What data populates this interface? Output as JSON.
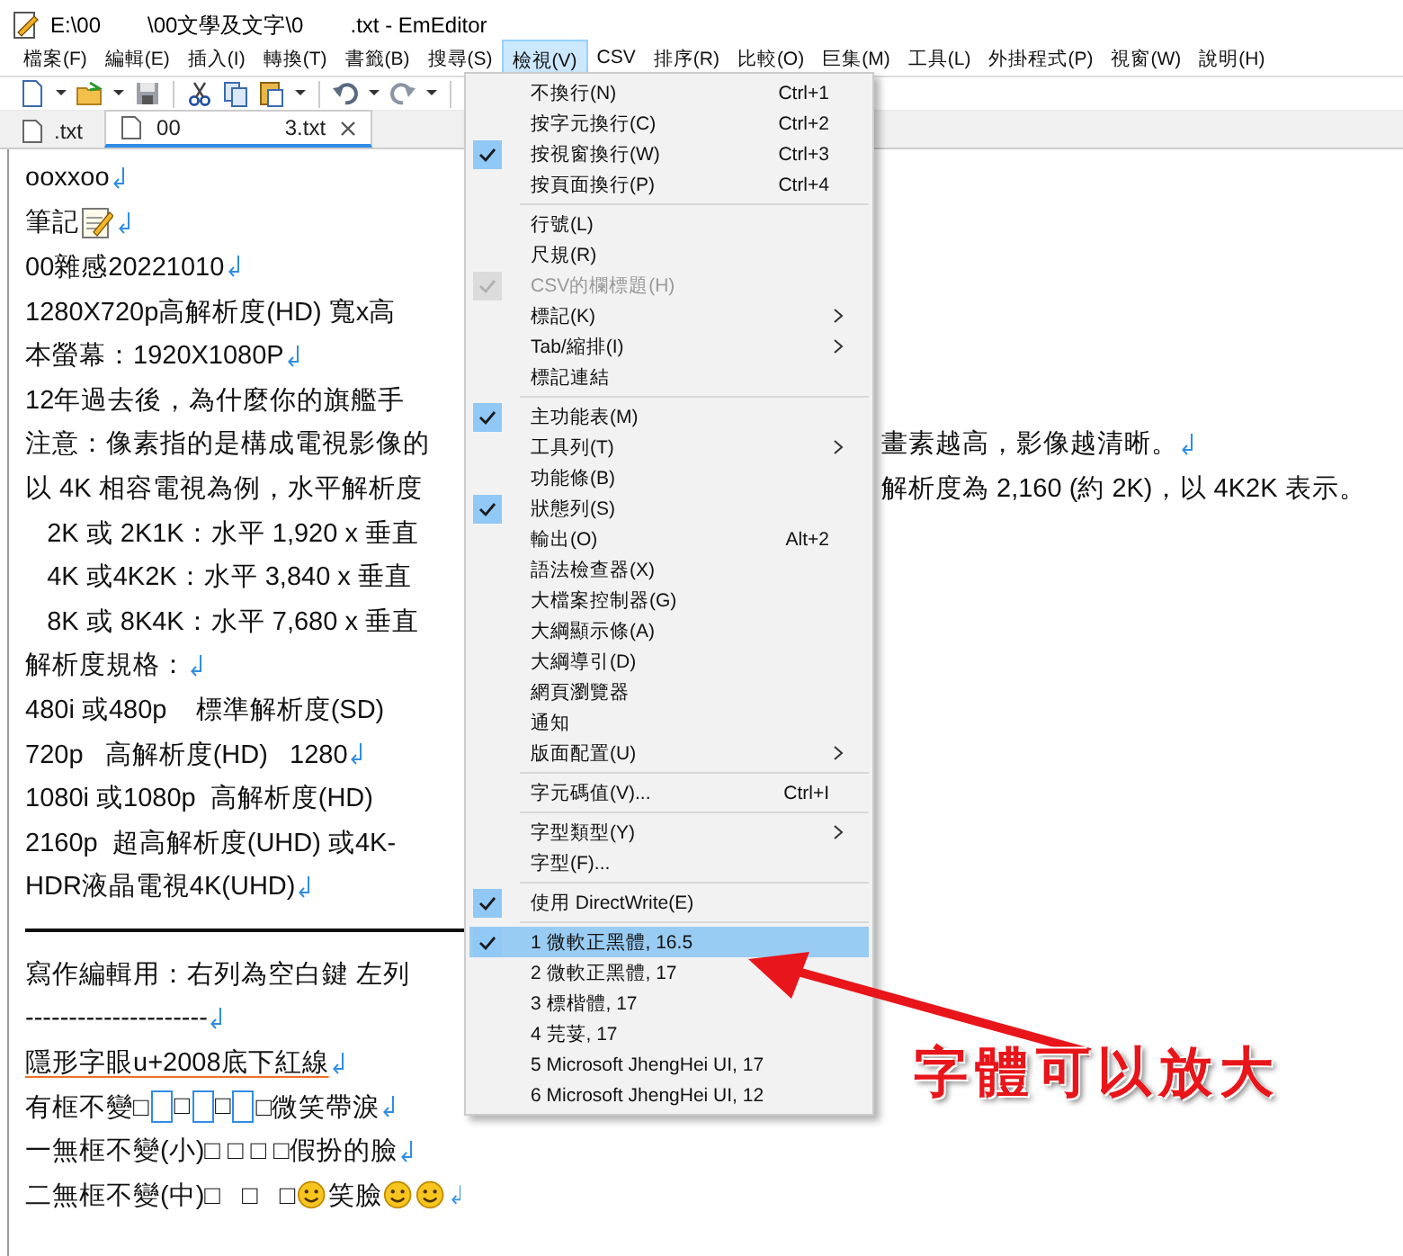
{
  "window": {
    "title_parts": [
      "E:\\00",
      "\\00文學及文字\\0",
      ".txt - EmEditor"
    ]
  },
  "menubar": [
    {
      "label": "檔案(F)",
      "selected": false
    },
    {
      "label": "編輯(E)",
      "selected": false
    },
    {
      "label": "插入(I)",
      "selected": false
    },
    {
      "label": "轉換(T)",
      "selected": false
    },
    {
      "label": "書籤(B)",
      "selected": false
    },
    {
      "label": "搜尋(S)",
      "selected": false
    },
    {
      "label": "檢視(V)",
      "selected": true
    },
    {
      "label": "CSV",
      "selected": false
    },
    {
      "label": "排序(R)",
      "selected": false
    },
    {
      "label": "比較(O)",
      "selected": false
    },
    {
      "label": "巨集(M)",
      "selected": false
    },
    {
      "label": "工具(L)",
      "selected": false
    },
    {
      "label": "外掛程式(P)",
      "selected": false
    },
    {
      "label": "視窗(W)",
      "selected": false
    },
    {
      "label": "說明(H)",
      "selected": false
    }
  ],
  "tabs": [
    {
      "label_parts": [
        ".txt"
      ],
      "selected": false,
      "closable": false
    },
    {
      "label_parts": [
        "00",
        "3.txt"
      ],
      "selected": true,
      "closable": true
    }
  ],
  "editor_lines": [
    {
      "kind": "text",
      "segments": [
        {
          "kind": "text",
          "text": "ooxxoo"
        }
      ],
      "eol": true
    },
    {
      "kind": "text",
      "segments": [
        {
          "kind": "text",
          "text": "筆記"
        },
        {
          "kind": "note"
        }
      ],
      "eol": true
    },
    {
      "kind": "text",
      "segments": [
        {
          "kind": "text",
          "text": "00雜感20221010"
        }
      ],
      "eol": true
    },
    {
      "kind": "text",
      "segments": [
        {
          "kind": "text",
          "text": "1280X720p高解析度(HD) 寬x高"
        }
      ],
      "eol": false
    },
    {
      "kind": "text",
      "segments": [
        {
          "kind": "text",
          "text": "本螢幕：1920X1080P"
        }
      ],
      "eol": true
    },
    {
      "kind": "text",
      "segments": [
        {
          "kind": "text",
          "text": "12年過去後，為什麼你的旗艦手"
        }
      ],
      "eol": false
    },
    {
      "kind": "text",
      "segments": [
        {
          "kind": "text",
          "text": "注意：像素指的是構成電視影像的"
        }
      ],
      "right": "畫素越高，影像越清晰。",
      "eol": true
    },
    {
      "kind": "text",
      "segments": [
        {
          "kind": "text",
          "text": "以 4K 相容電視為例，水平解析度"
        }
      ],
      "right": "解析度為 2,160 (約 2K)，以 4K2K 表示。",
      "eol": false
    },
    {
      "kind": "text",
      "segments": [
        {
          "kind": "text",
          "text": "   2K 或 2K1K：水平 1,920 x 垂直"
        }
      ],
      "eol": false
    },
    {
      "kind": "text",
      "segments": [
        {
          "kind": "text",
          "text": "   4K 或4K2K：水平 3,840 x 垂直"
        }
      ],
      "eol": false
    },
    {
      "kind": "text",
      "segments": [
        {
          "kind": "text",
          "text": "   8K 或 8K4K：水平 7,680 x 垂直"
        }
      ],
      "eol": false
    },
    {
      "kind": "text",
      "segments": [
        {
          "kind": "text",
          "text": "解析度規格："
        }
      ],
      "eol": true
    },
    {
      "kind": "text",
      "segments": [
        {
          "kind": "text",
          "text": "480i 或480p    標準解析度(SD)"
        }
      ],
      "eol": false
    },
    {
      "kind": "text",
      "segments": [
        {
          "kind": "text",
          "text": "720p   高解析度(HD)   1280"
        }
      ],
      "eol": true
    },
    {
      "kind": "text",
      "segments": [
        {
          "kind": "text",
          "text": "1080i 或1080p  高解析度(HD)"
        }
      ],
      "eol": false
    },
    {
      "kind": "text",
      "segments": [
        {
          "kind": "text",
          "text": "2160p  超高解析度(UHD) 或4K-"
        }
      ],
      "eol": false
    },
    {
      "kind": "text",
      "segments": [
        {
          "kind": "text",
          "text": "HDR液晶電視4K(UHD)"
        }
      ],
      "eol": true
    },
    {
      "kind": "rule"
    },
    {
      "kind": "text",
      "segments": [
        {
          "kind": "text",
          "text": "寫作編輯用：右列為空白鍵 左列"
        }
      ],
      "eol": false
    },
    {
      "kind": "text",
      "segments": [
        {
          "kind": "text",
          "text": "---------------------"
        }
      ],
      "eol": true
    },
    {
      "kind": "text",
      "underline": true,
      "segments": [
        {
          "kind": "text",
          "text": "隱形字眼u+2008底下紅線"
        }
      ],
      "eol": true
    },
    {
      "kind": "text",
      "segments": [
        {
          "kind": "text",
          "text": "有框不變□"
        },
        {
          "kind": "box"
        },
        {
          "kind": "text",
          "text": "□"
        },
        {
          "kind": "box"
        },
        {
          "kind": "text",
          "text": "□"
        },
        {
          "kind": "box"
        },
        {
          "kind": "text",
          "text": "□微笑帶淚"
        }
      ],
      "eol": true
    },
    {
      "kind": "text",
      "segments": [
        {
          "kind": "text",
          "text": "一無框不變(小)□ □ □ □假扮的臉"
        }
      ],
      "eol": true
    },
    {
      "kind": "text",
      "segments": [
        {
          "kind": "text",
          "text": "二無框不變(中)□   □   □"
        },
        {
          "kind": "smiley"
        },
        {
          "kind": "text",
          "text": "笑臉"
        },
        {
          "kind": "smiley"
        },
        {
          "kind": "smiley"
        }
      ],
      "eol": true
    }
  ],
  "view_menu": [
    {
      "kind": "item",
      "label": "不換行(N)",
      "shortcut": "Ctrl+1",
      "checked": false
    },
    {
      "kind": "item",
      "label": "按字元換行(C)",
      "shortcut": "Ctrl+2",
      "checked": false
    },
    {
      "kind": "item",
      "label": "按視窗換行(W)",
      "shortcut": "Ctrl+3",
      "checked": true
    },
    {
      "kind": "item",
      "label": "按頁面換行(P)",
      "shortcut": "Ctrl+4",
      "checked": false
    },
    {
      "kind": "separator"
    },
    {
      "kind": "item",
      "label": "行號(L)",
      "checked": false
    },
    {
      "kind": "item",
      "label": "尺規(R)",
      "checked": false
    },
    {
      "kind": "item",
      "label": "CSV的欄標題(H)",
      "checked": true,
      "disabled": true
    },
    {
      "kind": "item",
      "label": "標記(K)",
      "checked": false,
      "submenu": true
    },
    {
      "kind": "item",
      "label": "Tab/縮排(I)",
      "checked": false,
      "submenu": true
    },
    {
      "kind": "item",
      "label": "標記連結",
      "checked": false
    },
    {
      "kind": "separator"
    },
    {
      "kind": "item",
      "label": "主功能表(M)",
      "checked": true
    },
    {
      "kind": "item",
      "label": "工具列(T)",
      "checked": false,
      "submenu": true
    },
    {
      "kind": "item",
      "label": "功能條(B)",
      "checked": false
    },
    {
      "kind": "item",
      "label": "狀態列(S)",
      "checked": true
    },
    {
      "kind": "item",
      "label": "輸出(O)",
      "shortcut": "Alt+2",
      "checked": false
    },
    {
      "kind": "item",
      "label": "語法檢查器(X)",
      "checked": false
    },
    {
      "kind": "item",
      "label": "大檔案控制器(G)",
      "checked": false
    },
    {
      "kind": "item",
      "label": "大綱顯示條(A)",
      "checked": false
    },
    {
      "kind": "item",
      "label": "大綱導引(D)",
      "checked": false
    },
    {
      "kind": "item",
      "label": "網頁瀏覽器",
      "checked": false
    },
    {
      "kind": "item",
      "label": "通知",
      "checked": false
    },
    {
      "kind": "item",
      "label": "版面配置(U)",
      "checked": false,
      "submenu": true
    },
    {
      "kind": "separator"
    },
    {
      "kind": "item",
      "label": "字元碼值(V)...",
      "shortcut": "Ctrl+I",
      "checked": false
    },
    {
      "kind": "separator"
    },
    {
      "kind": "item",
      "label": "字型類型(Y)",
      "checked": false,
      "submenu": true
    },
    {
      "kind": "item",
      "label": "字型(F)...",
      "checked": false
    },
    {
      "kind": "separator"
    },
    {
      "kind": "item",
      "label": "使用 DirectWrite(E)",
      "checked": true
    },
    {
      "kind": "separator"
    },
    {
      "kind": "item",
      "label": "1 微軟正黑體, 16.5",
      "checked": true,
      "selected": true
    },
    {
      "kind": "item",
      "label": "2 微軟正黑體, 17",
      "checked": false,
      "selected": false
    },
    {
      "kind": "item",
      "label": "3 標楷體, 17",
      "checked": false,
      "selected": false
    },
    {
      "kind": "item",
      "label": "4 芫荽, 17",
      "checked": false,
      "selected": false
    },
    {
      "kind": "item",
      "label": "5 Microsoft JhengHei UI, 17",
      "checked": false,
      "selected": false
    },
    {
      "kind": "item",
      "label": "6 Microsoft JhengHei UI, 12",
      "checked": false,
      "selected": false
    }
  ],
  "annotation": {
    "text": "字體可以放大"
  }
}
